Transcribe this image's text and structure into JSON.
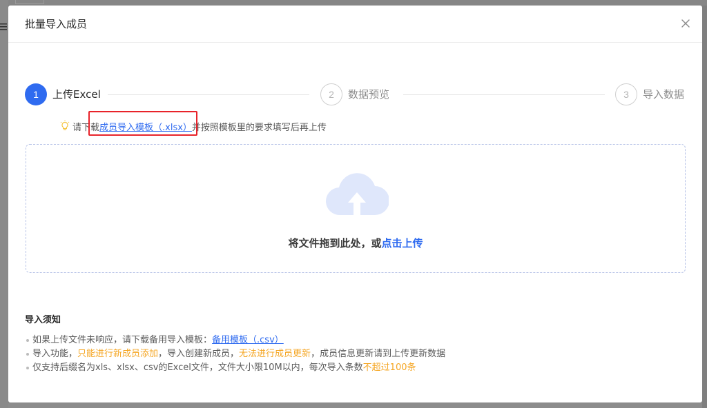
{
  "backdrop": {
    "menu_icon": "hamburger-icon"
  },
  "modal": {
    "title": "批量导入成员",
    "close_icon": "close-icon"
  },
  "steps": [
    {
      "number": "1",
      "label": "上传Excel",
      "state": "active"
    },
    {
      "number": "2",
      "label": "数据预览",
      "state": "inactive"
    },
    {
      "number": "3",
      "label": "导入数据",
      "state": "inactive"
    }
  ],
  "tip": {
    "icon": "lightbulb-icon",
    "prefix": "请下载",
    "link": "成员导入模板（.xlsx）",
    "suffix": "并按照模板里的要求填写后再上传"
  },
  "upload": {
    "icon": "cloud-upload-icon",
    "text": "将文件拖到此处，或",
    "link": "点击上传"
  },
  "notes": {
    "title": "导入须知",
    "item1": {
      "text": "如果上传文件未响应，请下载备用导入模板：",
      "link": "备用模板（.csv）"
    },
    "item2": {
      "t1": "导入功能，",
      "w1": "只能进行新成员添加",
      "t2": "，导入创建新成员，",
      "w2": "无法进行成员更新",
      "t3": "，成员信息更新请到上传更新数据"
    },
    "item3": {
      "t1": "仅支持后缀名为xls、xlsx、csv的Excel文件，文件大小限10M以内，每次导入条数",
      "w1": "不超过100条"
    }
  },
  "colors": {
    "accent": "#2f6bf0",
    "warning": "#f5a623",
    "highlight": "#e8232a"
  }
}
